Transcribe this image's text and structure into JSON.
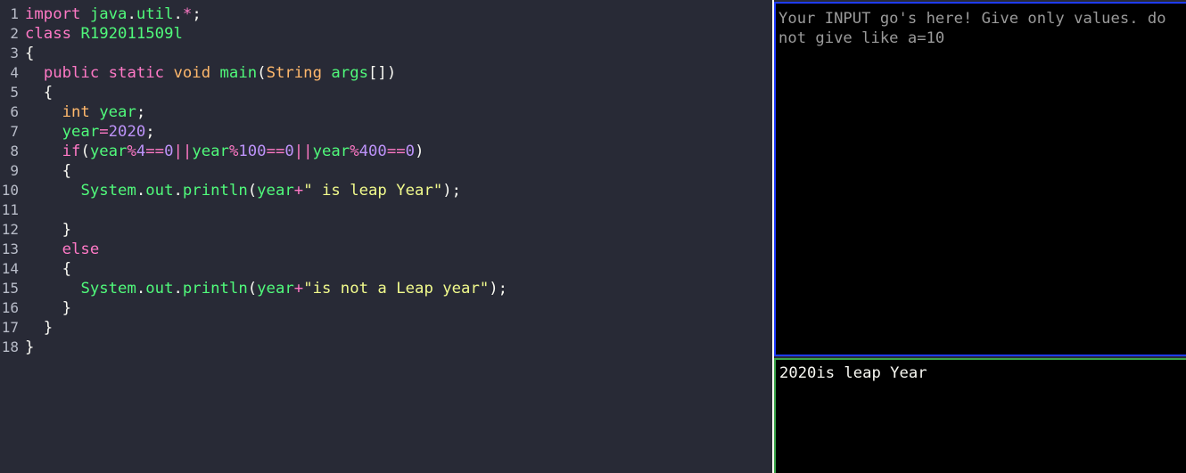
{
  "editor": {
    "language": "java",
    "lines": [
      {
        "n": "1",
        "tokens": [
          [
            "import",
            "keyword"
          ],
          [
            " ",
            "punct"
          ],
          [
            "java",
            "ident"
          ],
          [
            ".",
            "punct"
          ],
          [
            "util",
            "ident"
          ],
          [
            ".",
            "punct"
          ],
          [
            "*",
            "op"
          ],
          [
            ";",
            "punct"
          ]
        ]
      },
      {
        "n": "2",
        "tokens": [
          [
            "class",
            "keyword"
          ],
          [
            " ",
            "punct"
          ],
          [
            "R192011509l",
            "ident"
          ]
        ]
      },
      {
        "n": "3",
        "tokens": [
          [
            "{",
            "punct"
          ]
        ]
      },
      {
        "n": "4",
        "tokens": [
          [
            "  ",
            "punct"
          ],
          [
            "public",
            "keyword"
          ],
          [
            " ",
            "punct"
          ],
          [
            "static",
            "keyword"
          ],
          [
            " ",
            "punct"
          ],
          [
            "void",
            "type"
          ],
          [
            " ",
            "punct"
          ],
          [
            "main",
            "ident"
          ],
          [
            "(",
            "punct"
          ],
          [
            "String",
            "type"
          ],
          [
            " ",
            "punct"
          ],
          [
            "args",
            "ident"
          ],
          [
            "[])",
            "punct"
          ]
        ]
      },
      {
        "n": "5",
        "tokens": [
          [
            "  {",
            "punct"
          ]
        ]
      },
      {
        "n": "6",
        "tokens": [
          [
            "    ",
            "punct"
          ],
          [
            "int",
            "type"
          ],
          [
            " ",
            "punct"
          ],
          [
            "year",
            "ident"
          ],
          [
            ";",
            "punct"
          ]
        ]
      },
      {
        "n": "7",
        "tokens": [
          [
            "    ",
            "punct"
          ],
          [
            "year",
            "ident"
          ],
          [
            "=",
            "op"
          ],
          [
            "2020",
            "number"
          ],
          [
            ";",
            "punct"
          ]
        ]
      },
      {
        "n": "8",
        "tokens": [
          [
            "    ",
            "punct"
          ],
          [
            "if",
            "keyword"
          ],
          [
            "(",
            "punct"
          ],
          [
            "year",
            "ident"
          ],
          [
            "%",
            "op"
          ],
          [
            "4",
            "number"
          ],
          [
            "==",
            "op"
          ],
          [
            "0",
            "number"
          ],
          [
            "||",
            "op"
          ],
          [
            "year",
            "ident"
          ],
          [
            "%",
            "op"
          ],
          [
            "100",
            "number"
          ],
          [
            "==",
            "op"
          ],
          [
            "0",
            "number"
          ],
          [
            "||",
            "op"
          ],
          [
            "year",
            "ident"
          ],
          [
            "%",
            "op"
          ],
          [
            "400",
            "number"
          ],
          [
            "==",
            "op"
          ],
          [
            "0",
            "number"
          ],
          [
            ")",
            "punct"
          ]
        ]
      },
      {
        "n": "9",
        "tokens": [
          [
            "    {",
            "punct"
          ]
        ]
      },
      {
        "n": "10",
        "tokens": [
          [
            "      ",
            "punct"
          ],
          [
            "System",
            "ident"
          ],
          [
            ".",
            "punct"
          ],
          [
            "out",
            "ident"
          ],
          [
            ".",
            "punct"
          ],
          [
            "println",
            "ident"
          ],
          [
            "(",
            "punct"
          ],
          [
            "year",
            "ident"
          ],
          [
            "+",
            "op"
          ],
          [
            "\" is leap Year\"",
            "string"
          ],
          [
            ");",
            "punct"
          ]
        ]
      },
      {
        "n": "11",
        "tokens": []
      },
      {
        "n": "12",
        "tokens": [
          [
            "    }",
            "punct"
          ]
        ]
      },
      {
        "n": "13",
        "tokens": [
          [
            "    ",
            "punct"
          ],
          [
            "else",
            "keyword"
          ]
        ]
      },
      {
        "n": "14",
        "tokens": [
          [
            "    {",
            "punct"
          ]
        ]
      },
      {
        "n": "15",
        "tokens": [
          [
            "      ",
            "punct"
          ],
          [
            "System",
            "ident"
          ],
          [
            ".",
            "punct"
          ],
          [
            "out",
            "ident"
          ],
          [
            ".",
            "punct"
          ],
          [
            "println",
            "ident"
          ],
          [
            "(",
            "punct"
          ],
          [
            "year",
            "ident"
          ],
          [
            "+",
            "op"
          ],
          [
            "\"is not a Leap year\"",
            "string"
          ],
          [
            ");",
            "punct"
          ]
        ]
      },
      {
        "n": "16",
        "tokens": [
          [
            "    }",
            "punct"
          ]
        ]
      },
      {
        "n": "17",
        "tokens": [
          [
            "  }",
            "punct"
          ]
        ]
      },
      {
        "n": "18",
        "tokens": [
          [
            "}",
            "punct"
          ]
        ]
      }
    ]
  },
  "input_pane": {
    "placeholder": "Your INPUT go's here! Give only values. do\nnot give like a=10",
    "value": ""
  },
  "output_pane": {
    "text": "2020is leap Year"
  },
  "colors": {
    "editor_bg": "#282a36",
    "keyword": "#ff79c6",
    "type": "#ffb86c",
    "identifier": "#50fa7b",
    "string": "#f1fa8c",
    "number": "#bd93f9",
    "input_border": "#1f3cff",
    "output_border": "#3aa64a"
  }
}
